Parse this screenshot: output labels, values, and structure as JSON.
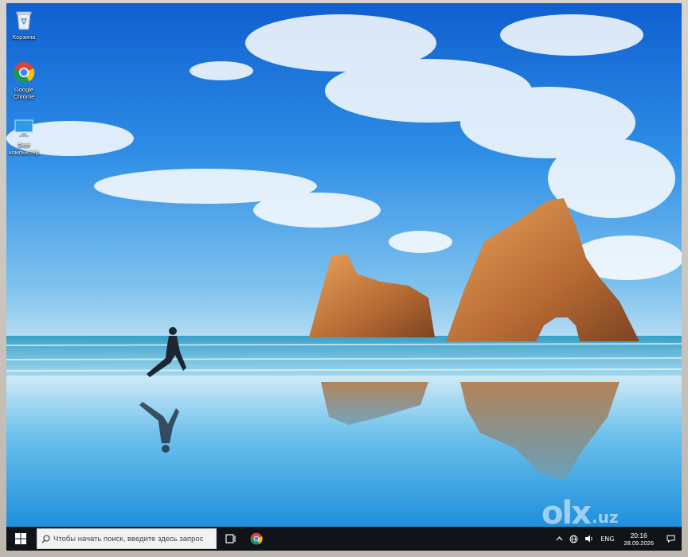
{
  "desktop": {
    "icons": [
      {
        "label": "Корзина",
        "icon": "recycle-bin-icon"
      },
      {
        "label": "Google Chrome",
        "icon": "chrome-icon"
      },
      {
        "label": "Этот компьютер",
        "icon": "this-pc-icon"
      }
    ]
  },
  "taskbar": {
    "start_icon": "windows-logo-icon",
    "search": {
      "placeholder": "Чтобы начать поиск, введите здесь запрос"
    },
    "task_view_icon": "task-view-icon",
    "pinned": [
      {
        "icon": "chrome-icon"
      }
    ],
    "tray": {
      "chevron_icon": "chevron-up-icon",
      "network_icon": "network-icon",
      "volume_icon": "volume-icon",
      "language": "ENG",
      "time": "20:16",
      "date": "28.09.2026",
      "notification_icon": "notification-icon"
    }
  },
  "watermark": {
    "brand": "olx",
    "suffix": ".uz"
  },
  "colors": {
    "sky": "#1a6fd6",
    "sea": "#7fc6e4",
    "rock": "#c77a3e",
    "taskbar": "#101418"
  }
}
